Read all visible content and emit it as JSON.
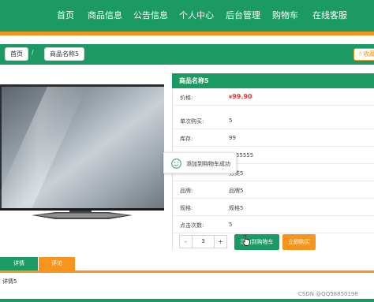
{
  "nav": {
    "items": [
      "首页",
      "商品信息",
      "公告信息",
      "个人中心",
      "后台管理",
      "购物车",
      "在线客服"
    ]
  },
  "breadcrumb": {
    "home": "首页",
    "current": "商品名称5"
  },
  "favorite": {
    "label": "☆收藏"
  },
  "product": {
    "title": "商品名称5",
    "price_label": "价格:",
    "currency": "¥",
    "price": "99.90",
    "fields": [
      {
        "label": "单次购买:",
        "value": "5"
      },
      {
        "label": "库存:",
        "value": "99"
      },
      {
        "label": "",
        "value": "5555555"
      },
      {
        "label": "",
        "value": "分类5"
      },
      {
        "label": "品牌:",
        "value": "品牌5"
      },
      {
        "label": "规格:",
        "value": "规格5"
      },
      {
        "label": "点击次数:",
        "value": "5"
      }
    ]
  },
  "quantity": {
    "minus": "-",
    "value": "3",
    "plus": "+"
  },
  "actions": {
    "add_to_cart": "添加到购物车",
    "buy_now": "立即购买"
  },
  "toast": {
    "message": "添加到购物车成功"
  },
  "tabs": {
    "detail": "详情",
    "review": "评论"
  },
  "detail_content": "详情5",
  "watermark": "CSDN @QQ58850198",
  "colors": {
    "primary": "#1b9b63",
    "accent": "#f7941d",
    "price": "#e4393c"
  }
}
